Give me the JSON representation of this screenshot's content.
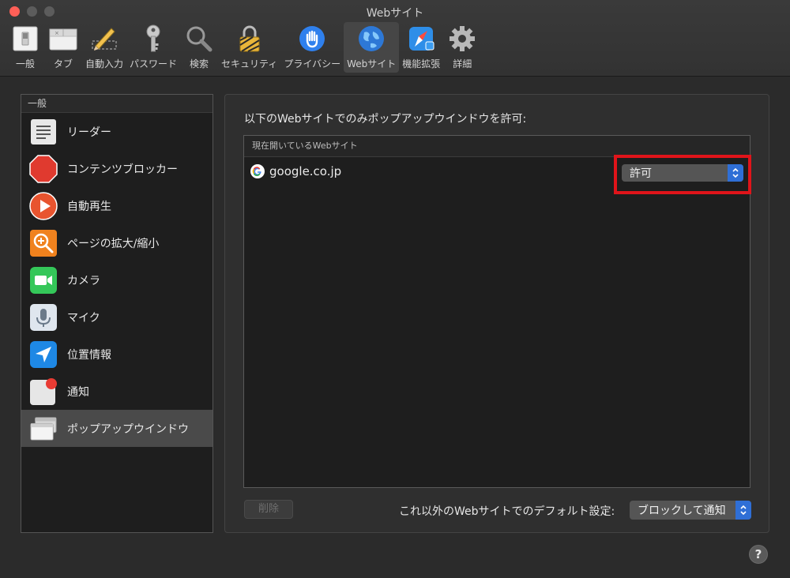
{
  "window": {
    "title": "Webサイト"
  },
  "toolbar": {
    "items": [
      {
        "label": "一般",
        "icon": "switch-icon"
      },
      {
        "label": "タブ",
        "icon": "tabs-icon"
      },
      {
        "label": "自動入力",
        "icon": "pencil-icon"
      },
      {
        "label": "パスワード",
        "icon": "key-icon"
      },
      {
        "label": "検索",
        "icon": "magnifier-icon"
      },
      {
        "label": "セキュリティ",
        "icon": "lock-icon"
      },
      {
        "label": "プライバシー",
        "icon": "hand-icon"
      },
      {
        "label": "Webサイト",
        "icon": "globe-icon"
      },
      {
        "label": "機能拡張",
        "icon": "compass-icon"
      },
      {
        "label": "詳細",
        "icon": "gear-icon"
      }
    ],
    "selected": "Webサイト"
  },
  "sidebar": {
    "section": "一般",
    "items": [
      {
        "label": "リーダー",
        "icon": "reader-icon"
      },
      {
        "label": "コンテンツブロッカー",
        "icon": "stop-sign-icon"
      },
      {
        "label": "自動再生",
        "icon": "play-icon"
      },
      {
        "label": "ページの拡大/縮小",
        "icon": "zoom-icon"
      },
      {
        "label": "カメラ",
        "icon": "camera-icon"
      },
      {
        "label": "マイク",
        "icon": "microphone-icon"
      },
      {
        "label": "位置情報",
        "icon": "location-icon"
      },
      {
        "label": "通知",
        "icon": "notification-icon"
      },
      {
        "label": "ポップアップウインドウ",
        "icon": "popup-window-icon"
      }
    ],
    "selected": "ポップアップウインドウ"
  },
  "main": {
    "heading": "以下のWebサイトでのみポップアップウインドウを許可:",
    "table_header": "現在開いているWebサイト",
    "rows": [
      {
        "site": "google.co.jp",
        "setting": "許可"
      }
    ],
    "delete_label": "削除",
    "default_label": "これ以外のWebサイトでのデフォルト設定:",
    "default_value": "ブロックして通知"
  },
  "help_label": "?",
  "colors": {
    "accent": "#2f6fd6",
    "highlight": "#e0141a",
    "background": "#2b2b2b"
  }
}
